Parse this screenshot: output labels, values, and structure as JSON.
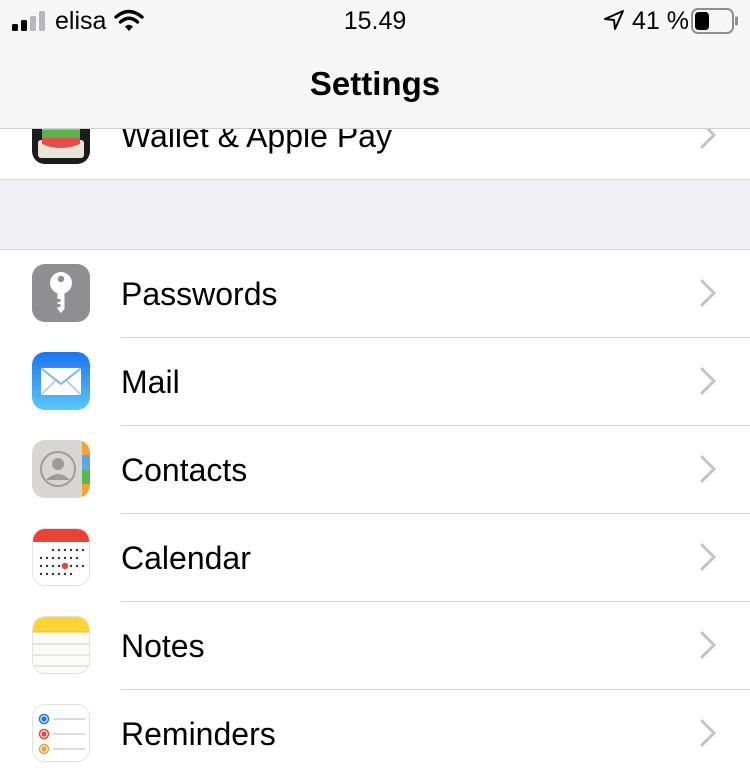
{
  "status_bar": {
    "carrier": "elisa",
    "time": "15.49",
    "battery_percent": "41 %",
    "signal_bars": 2,
    "battery_level": 0.41,
    "icons": [
      "signal-icon",
      "wifi-icon",
      "location-arrow-icon",
      "battery-icon"
    ]
  },
  "nav": {
    "title": "Settings"
  },
  "rows": [
    {
      "label": "Wallet & Apple Pay",
      "icon": "wallet-icon"
    },
    {
      "label": "Passwords",
      "icon": "key-icon"
    },
    {
      "label": "Mail",
      "icon": "mail-icon"
    },
    {
      "label": "Contacts",
      "icon": "contacts-icon"
    },
    {
      "label": "Calendar",
      "icon": "calendar-icon"
    },
    {
      "label": "Notes",
      "icon": "notes-icon"
    },
    {
      "label": "Reminders",
      "icon": "reminders-icon"
    }
  ],
  "colors": {
    "header_bg": "#f7f7f8",
    "group_gap_bg": "#efeff4",
    "separator": "#d4d4d8",
    "chevron": "#c4c4c7",
    "passwords_icon": "#8e8e93",
    "mail_icon": "#1e90ff",
    "calendar_red": "#ea4335",
    "notes_yellow": "#fcd535"
  }
}
